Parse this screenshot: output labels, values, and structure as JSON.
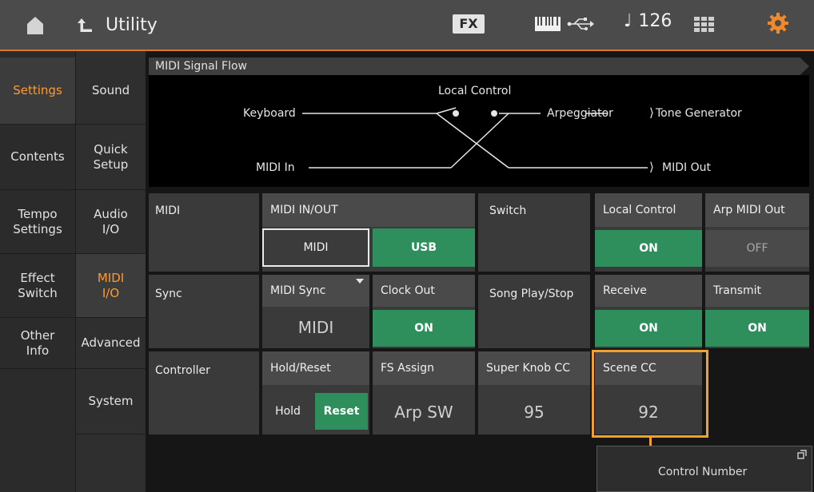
{
  "topbar": {
    "title": "Utility",
    "fx_label": "FX",
    "tempo_symbol": "♩",
    "tempo_value": "126",
    "icons": [
      "home-icon",
      "back-arrow-icon",
      "keyboard-icon",
      "usb-icon",
      "grid-icon",
      "gear-icon"
    ]
  },
  "nav_primary": [
    "Settings",
    "Contents",
    "Tempo\nSettings",
    "Effect\nSwitch",
    "Other\nInfo"
  ],
  "nav_secondary": [
    "Sound",
    "Quick\nSetup",
    "Audio\nI/O",
    "MIDI\nI/O",
    "Advanced",
    "System"
  ],
  "signal_flow": {
    "title": "MIDI Signal Flow",
    "local_control": "Local Control",
    "keyboard": "Keyboard",
    "arpeggiator": "Arpeggiator",
    "tone_generator": "Tone Generator",
    "midi_in": "MIDI In",
    "midi_out": "MIDI Out",
    "arrow": "⟩"
  },
  "midi_row": {
    "label": "MIDI",
    "header": "MIDI IN/OUT",
    "option_midi": "MIDI",
    "option_usb": "USB"
  },
  "switch_row": {
    "label": "Switch",
    "local_control_header": "Local Control",
    "local_control_value": "ON",
    "arp_midi_out_header": "Arp MIDI Out",
    "arp_midi_out_value": "OFF"
  },
  "sync_row": {
    "label": "Sync",
    "midi_sync_header": "MIDI Sync",
    "midi_sync_value": "MIDI",
    "clock_out_header": "Clock Out",
    "clock_out_value": "ON"
  },
  "song_row": {
    "label": "Song Play/Stop",
    "receive_header": "Receive",
    "receive_value": "ON",
    "transmit_header": "Transmit",
    "transmit_value": "ON"
  },
  "controller_row": {
    "label": "Controller",
    "hold_reset_header": "Hold/Reset",
    "hold_label": "Hold",
    "reset_label": "Reset",
    "fs_assign_header": "FS Assign",
    "fs_assign_value": "Arp SW",
    "super_knob_header": "Super Knob CC",
    "super_knob_value": "95",
    "scene_cc_header": "Scene CC",
    "scene_cc_value": "92"
  },
  "popup": {
    "control_number_label": "Control Number"
  },
  "colors": {
    "accent": "#f2a12e",
    "on_green": "#2f8f5c",
    "active_nav": "#ff9a2e"
  }
}
